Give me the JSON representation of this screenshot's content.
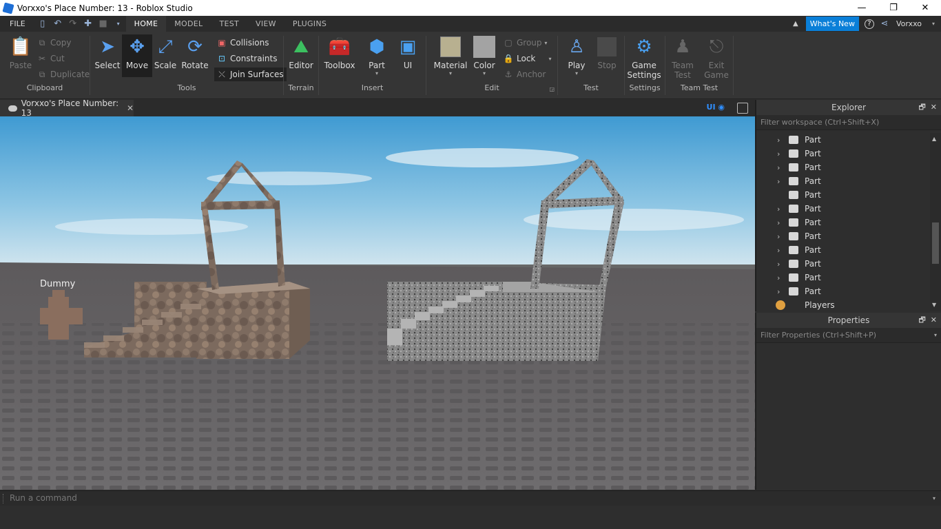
{
  "window": {
    "title": "Vorxxo's Place Number: 13 - Roblox Studio",
    "minimize": "—",
    "maximize": "❐",
    "close": "✕"
  },
  "menu": {
    "file": "FILE",
    "tabs": [
      "HOME",
      "MODEL",
      "TEST",
      "VIEW",
      "PLUGINS"
    ],
    "active_tab": "HOME",
    "whats_new": "What's New",
    "help": "?",
    "username": "Vorxxo"
  },
  "ribbon": {
    "clipboard": {
      "label": "Clipboard",
      "paste": "Paste",
      "copy": "Copy",
      "cut": "Cut",
      "duplicate": "Duplicate"
    },
    "tools": {
      "label": "Tools",
      "select": "Select",
      "move": "Move",
      "scale": "Scale",
      "rotate": "Rotate",
      "collisions": "Collisions",
      "constraints": "Constraints",
      "join_surfaces": "Join Surfaces"
    },
    "terrain": {
      "label": "Terrain",
      "editor": "Editor"
    },
    "insert": {
      "label": "Insert",
      "toolbox": "Toolbox",
      "part": "Part",
      "ui": "UI"
    },
    "edit": {
      "label": "Edit",
      "material": "Material",
      "color": "Color",
      "group": "Group",
      "lock": "Lock",
      "anchor": "Anchor"
    },
    "test": {
      "label": "Test",
      "play": "Play",
      "stop": "Stop"
    },
    "settings": {
      "label": "Settings",
      "game_settings_1": "Game",
      "game_settings_2": "Settings"
    },
    "team_test": {
      "label": "Team Test",
      "team_test_1": "Team",
      "team_test_2": "Test",
      "exit_game_1": "Exit",
      "exit_game_2": "Game"
    }
  },
  "document_tab": {
    "title": "Vorxxo's Place Number: 13",
    "close": "✕",
    "ui_toggle": "UI"
  },
  "viewport": {
    "dummy_label": "Dummy"
  },
  "explorer": {
    "title": "Explorer",
    "filter_placeholder": "Filter workspace (Ctrl+Shift+X)",
    "items": [
      {
        "name": "Part",
        "expandable": true
      },
      {
        "name": "Part",
        "expandable": true
      },
      {
        "name": "Part",
        "expandable": true
      },
      {
        "name": "Part",
        "expandable": true
      },
      {
        "name": "Part",
        "expandable": false
      },
      {
        "name": "Part",
        "expandable": true
      },
      {
        "name": "Part",
        "expandable": true
      },
      {
        "name": "Part",
        "expandable": true
      },
      {
        "name": "Part",
        "expandable": true
      },
      {
        "name": "Part",
        "expandable": true
      },
      {
        "name": "Part",
        "expandable": true
      },
      {
        "name": "Part",
        "expandable": true
      }
    ],
    "players": "Players"
  },
  "properties": {
    "title": "Properties",
    "filter_placeholder": "Filter Properties (Ctrl+Shift+P)"
  },
  "command_bar": {
    "placeholder": "Run a command"
  },
  "colors": {
    "accent": "#0a7fd8",
    "ribbon_bg": "#353535",
    "sky": "#4a9fd0",
    "baseplate": "#676767"
  }
}
